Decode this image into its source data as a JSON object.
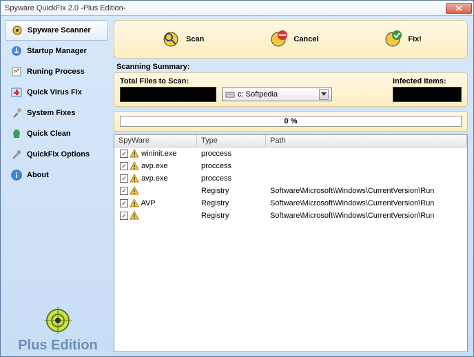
{
  "window": {
    "title": "Spyware QuickFix 2.0 -Plus Edition-"
  },
  "sidebar": {
    "items": [
      {
        "label": "Spyware Scanner"
      },
      {
        "label": "Startup Manager"
      },
      {
        "label": "Runing Process"
      },
      {
        "label": "Quick Virus Fix"
      },
      {
        "label": "System Fixes"
      },
      {
        "label": "Quick Clean"
      },
      {
        "label": "QuickFix Options"
      },
      {
        "label": "About"
      }
    ],
    "brand_text": "Plus Edition"
  },
  "toolbar": {
    "scan": "Scan",
    "cancel": "Cancel",
    "fix": "Fix!"
  },
  "summary": {
    "heading": "Scanning Summary:",
    "total_label": "Total Files to Scan:",
    "drive_label": "c: Softpedia",
    "infected_label": "Infected Items:"
  },
  "progress": {
    "text": "0 %"
  },
  "grid": {
    "headers": {
      "c1": "SpyWare",
      "c2": "Type",
      "c3": "Path"
    },
    "rows": [
      {
        "name": "wininit.exe",
        "type": "proccess",
        "path": ""
      },
      {
        "name": "avp.exe",
        "type": "proccess",
        "path": ""
      },
      {
        "name": "avp.exe",
        "type": "proccess",
        "path": ""
      },
      {
        "name": "",
        "type": "Registry",
        "path": "Software\\Microsoft\\Windows\\CurrentVersion\\Run"
      },
      {
        "name": "AVP",
        "type": "Registry",
        "path": "Software\\Microsoft\\Windows\\CurrentVersion\\Run"
      },
      {
        "name": "",
        "type": "Registry",
        "path": "Software\\Microsoft\\Windows\\CurrentVersion\\Run"
      }
    ]
  }
}
